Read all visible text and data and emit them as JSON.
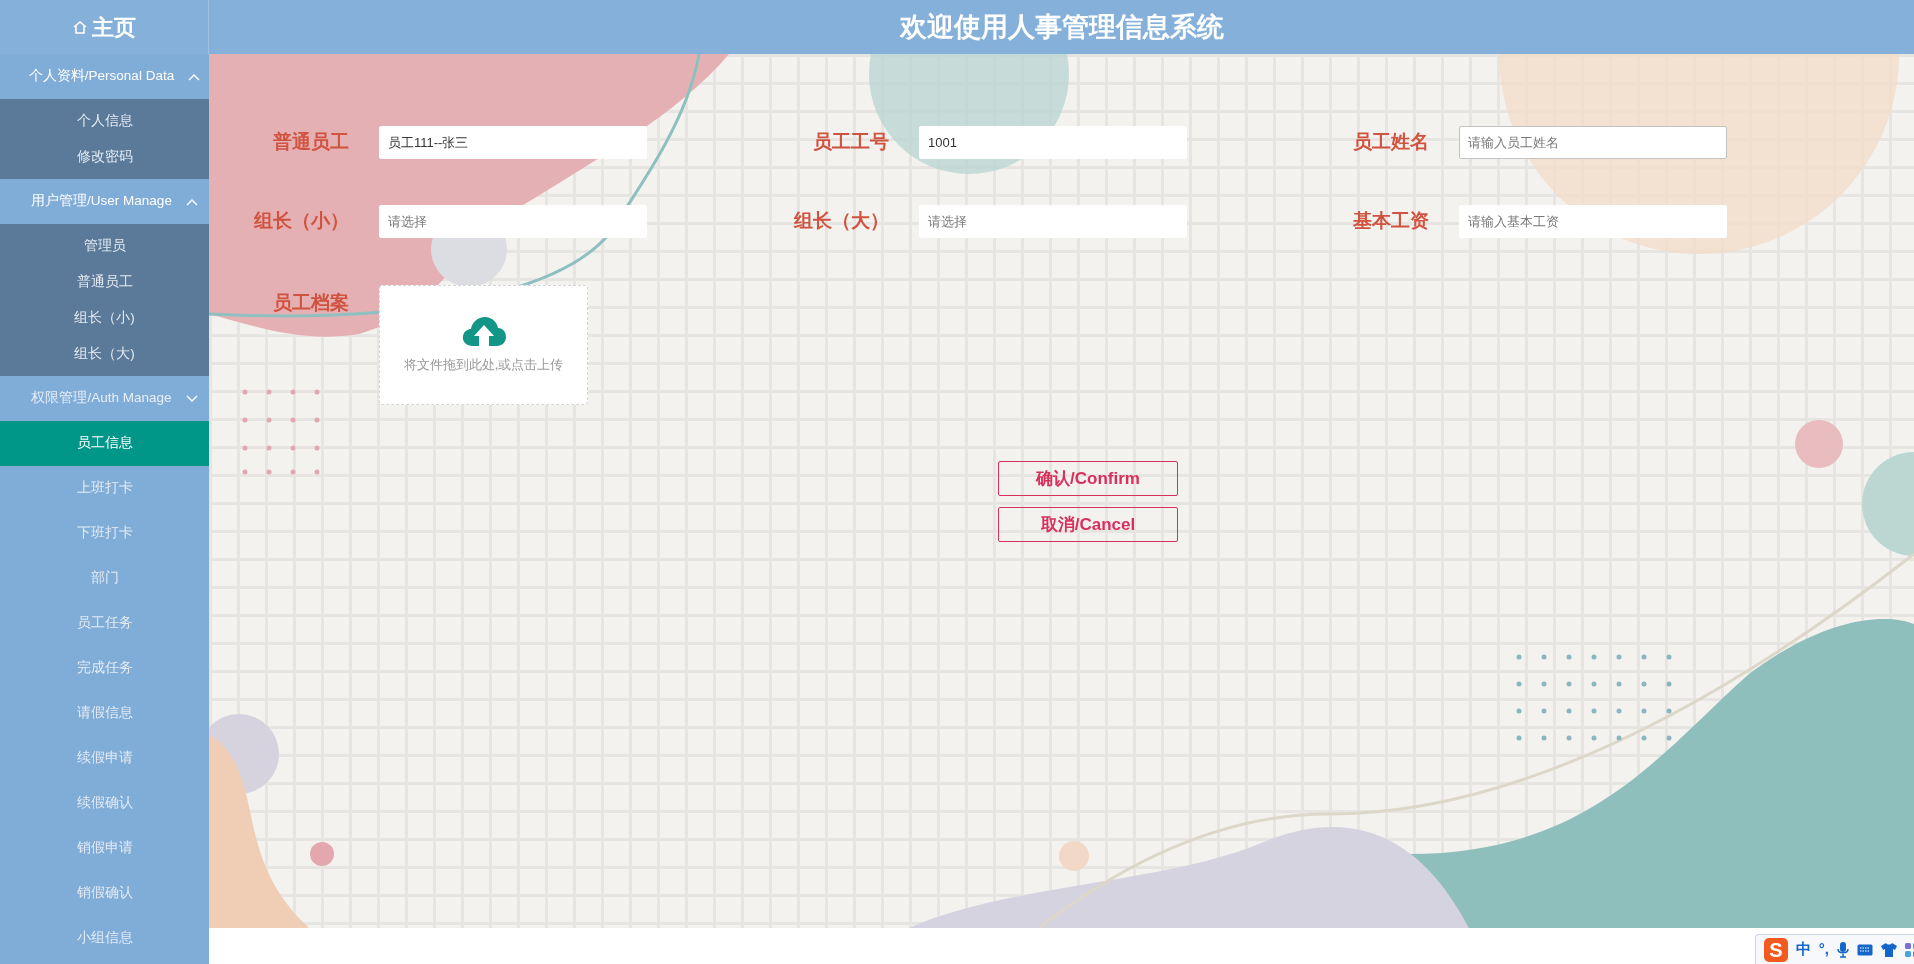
{
  "header": {
    "home_label": "主页",
    "title": "欢迎使用人事管理信息系统"
  },
  "sidebar": {
    "menu": [
      {
        "kind": "group",
        "label": "个人资料/Personal Data",
        "expanded": true,
        "children": [
          {
            "label": "个人信息",
            "selected": false
          },
          {
            "label": "修改密码",
            "selected": false
          }
        ]
      },
      {
        "kind": "group",
        "label": "用户管理/User Manage",
        "expanded": true,
        "children": [
          {
            "label": "管理员",
            "selected": false
          },
          {
            "label": "普通员工",
            "selected": false
          },
          {
            "label": "组长（小)",
            "selected": false
          },
          {
            "label": "组长（大)",
            "selected": false
          }
        ]
      },
      {
        "kind": "group",
        "label": "权限管理/Auth Manage",
        "expanded": false
      },
      {
        "kind": "item",
        "label": "员工信息",
        "selected": true
      },
      {
        "kind": "item",
        "label": "上班打卡",
        "selected": false
      },
      {
        "kind": "item",
        "label": "下班打卡",
        "selected": false
      },
      {
        "kind": "item",
        "label": "部门",
        "selected": false
      },
      {
        "kind": "item",
        "label": "员工任务",
        "selected": false
      },
      {
        "kind": "item",
        "label": "完成任务",
        "selected": false
      },
      {
        "kind": "item",
        "label": "请假信息",
        "selected": false
      },
      {
        "kind": "item",
        "label": "续假申请",
        "selected": false
      },
      {
        "kind": "item",
        "label": "续假确认",
        "selected": false
      },
      {
        "kind": "item",
        "label": "销假申请",
        "selected": false
      },
      {
        "kind": "item",
        "label": "销假确认",
        "selected": false
      },
      {
        "kind": "item",
        "label": "小组信息",
        "selected": false
      }
    ]
  },
  "form": {
    "fields": [
      {
        "label": "普通员工",
        "value": "员工111--张三",
        "focused": false
      },
      {
        "label": "员工工号",
        "value": "1001",
        "focused": false
      },
      {
        "label": "员工姓名",
        "placeholder": "请输入员工姓名",
        "focused": true
      },
      {
        "label": "组长（小）",
        "placeholder": "请选择",
        "focused": false
      },
      {
        "label": "组长（大）",
        "placeholder": "请选择",
        "focused": false
      },
      {
        "label": "基本工资",
        "placeholder": "请输入基本工资",
        "focused": false
      }
    ],
    "upload": {
      "label": "员工档案",
      "hint": "将文件拖到此处,或点击上传"
    },
    "buttons": [
      "确认/Confirm",
      "取消/Cancel"
    ]
  },
  "ime_bar": {
    "logo": "S",
    "texts": [
      "中",
      "°,"
    ]
  }
}
